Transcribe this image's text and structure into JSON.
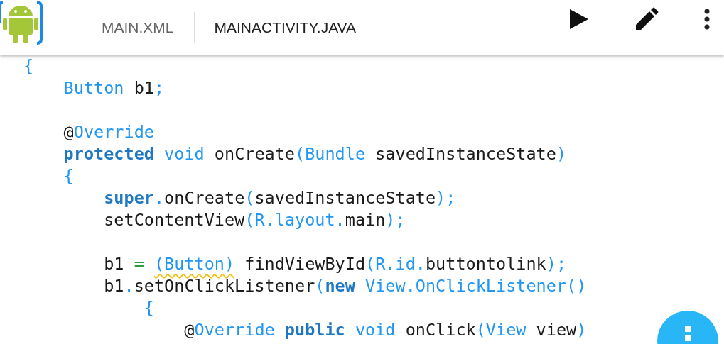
{
  "toolbar": {
    "tabs": [
      {
        "label": "MAIN.XML",
        "selected": false
      },
      {
        "label": "MAINACTIVITY.JAVA",
        "selected": true
      }
    ]
  },
  "editor": {
    "lines": [
      {
        "kind": "code",
        "tokens": [
          {
            "t": "{",
            "kind": "type"
          }
        ]
      },
      {
        "kind": "code",
        "tokens": [
          {
            "t": "    Button",
            "kind": "type"
          },
          {
            "t": " b1",
            "kind": "plain"
          },
          {
            "t": ";",
            "kind": "type"
          }
        ]
      },
      {
        "kind": "blank"
      },
      {
        "kind": "code",
        "tokens": [
          {
            "t": "    @",
            "kind": "plain"
          },
          {
            "t": "Override",
            "kind": "type"
          }
        ]
      },
      {
        "kind": "code",
        "tokens": [
          {
            "t": "    protected",
            "kind": "keyword"
          },
          {
            "t": " void",
            "kind": "type"
          },
          {
            "t": " onCreate",
            "kind": "plain"
          },
          {
            "t": "(Bundle",
            "kind": "type"
          },
          {
            "t": " savedInstanceState",
            "kind": "plain"
          },
          {
            "t": ")",
            "kind": "type"
          }
        ]
      },
      {
        "kind": "code",
        "tokens": [
          {
            "t": "    {",
            "kind": "type"
          }
        ]
      },
      {
        "kind": "code",
        "tokens": [
          {
            "t": "        super",
            "kind": "keyword"
          },
          {
            "t": ".",
            "kind": "type"
          },
          {
            "t": "onCreate",
            "kind": "plain"
          },
          {
            "t": "(",
            "kind": "type"
          },
          {
            "t": "savedInstanceState",
            "kind": "plain"
          },
          {
            "t": ");",
            "kind": "type"
          }
        ]
      },
      {
        "kind": "code",
        "tokens": [
          {
            "t": "        setContentView",
            "kind": "plain"
          },
          {
            "t": "(R.layout.",
            "kind": "type"
          },
          {
            "t": "main",
            "kind": "plain"
          },
          {
            "t": ");",
            "kind": "type"
          }
        ]
      },
      {
        "kind": "blank"
      },
      {
        "kind": "code",
        "tokens": [
          {
            "t": "        b1 ",
            "kind": "plain"
          },
          {
            "t": "= ",
            "kind": "operator"
          },
          {
            "t": "(Button)",
            "kind": "type",
            "warning": true
          },
          {
            "t": " findViewById",
            "kind": "plain"
          },
          {
            "t": "(R.id.",
            "kind": "type"
          },
          {
            "t": "buttontolink",
            "kind": "plain"
          },
          {
            "t": ");",
            "kind": "type"
          }
        ]
      },
      {
        "kind": "code",
        "tokens": [
          {
            "t": "        b1",
            "kind": "plain"
          },
          {
            "t": ".",
            "kind": "type"
          },
          {
            "t": "setOnClickListener",
            "kind": "plain"
          },
          {
            "t": "(",
            "kind": "type"
          },
          {
            "t": "new",
            "kind": "keyword"
          },
          {
            "t": " View.OnClickListener()",
            "kind": "type"
          }
        ]
      },
      {
        "kind": "code",
        "tokens": [
          {
            "t": "            {",
            "kind": "type"
          }
        ]
      },
      {
        "kind": "code",
        "tokens": [
          {
            "t": "                @",
            "kind": "plain"
          },
          {
            "t": "Override",
            "kind": "type"
          },
          {
            "t": " public",
            "kind": "keyword"
          },
          {
            "t": " void",
            "kind": "type"
          },
          {
            "t": " onClick",
            "kind": "plain"
          },
          {
            "t": "(View",
            "kind": "type"
          },
          {
            "t": " view",
            "kind": "plain"
          },
          {
            "t": ")",
            "kind": "type"
          }
        ]
      }
    ]
  }
}
